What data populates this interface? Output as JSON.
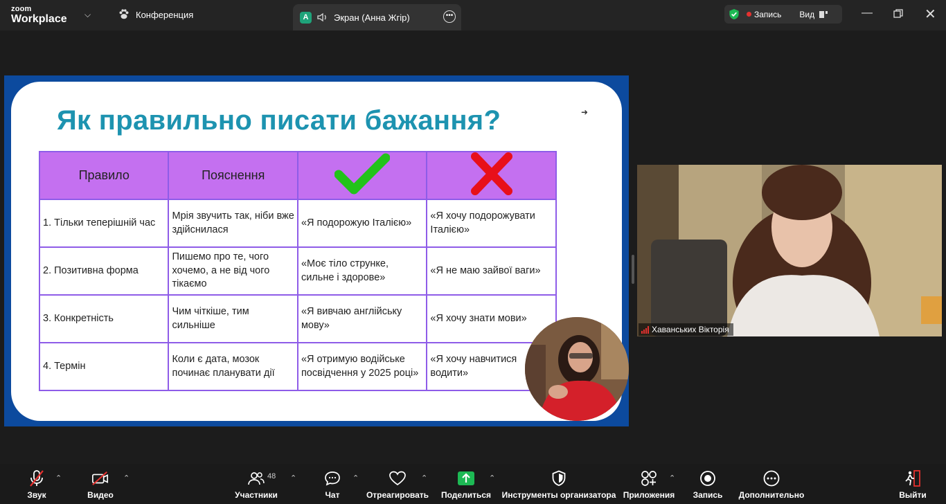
{
  "app": {
    "logo_line1": "zoom",
    "logo_line2": "Workplace"
  },
  "tabs": {
    "conference": "Конференция",
    "screen": "Экран (Анна Жгір)",
    "screen_avatar": "A"
  },
  "top_right": {
    "record": "Запись",
    "view": "Вид"
  },
  "slide": {
    "title": "Як правильно писати бажання?",
    "headers": [
      "Правило",
      "Пояснення"
    ],
    "rows": [
      [
        "1. Тільки теперішній час",
        "Мрія звучить так, ніби вже здійснилася",
        "«Я подорожую Італією»",
        "«Я хочу подорожувати Італією»"
      ],
      [
        "2. Позитивна форма",
        "Пишемо про те, чого хочемо, а не від чого тікаємо",
        "«Моє тіло струнке, сильне і здорове»",
        "«Я не маю зайвої ваги»"
      ],
      [
        "3. Конкретність",
        "Чим чіткіше, тим сильніше",
        "«Я вивчаю англійську мову»",
        "«Я хочу знати мови»"
      ],
      [
        "4. Термін",
        "Коли є дата, мозок починає планувати дії",
        "«Я отримую водійське посвідчення у 2025 році»",
        "«Я хочу навчитися водити»"
      ]
    ]
  },
  "participant": {
    "name": "Хаванських Вікторія"
  },
  "toolbar": {
    "audio": "Звук",
    "video": "Видео",
    "participants": "Участники",
    "participants_count": "48",
    "chat": "Чат",
    "react": "Отреагировать",
    "share": "Поделиться",
    "host_tools": "Инструменты организатора",
    "apps": "Приложения",
    "record": "Запись",
    "more": "Дополнительно",
    "leave": "Выйти"
  },
  "colors": {
    "accent_green": "#1fa37a",
    "share_green": "#1db954",
    "record_red": "#e5312f",
    "slide_title": "#1d93b0",
    "table_header": "#c470f0"
  }
}
